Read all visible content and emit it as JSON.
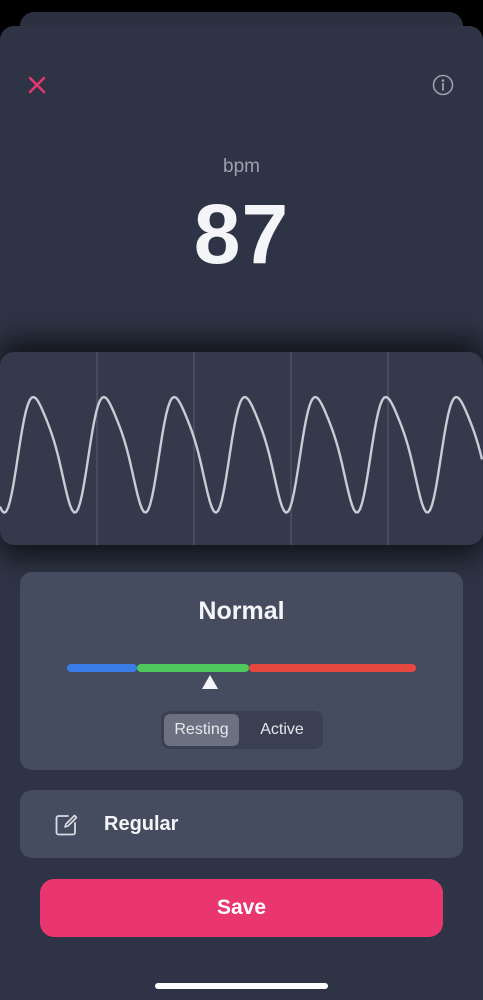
{
  "colors": {
    "accent": "#ea3670",
    "sheet_background": "#2e3445",
    "card_background": "#454c5f",
    "range_low": "#3b7de8",
    "range_normal": "#4ec95e",
    "range_high": "#e5483f"
  },
  "header": {
    "close_icon": "close-x-icon",
    "info_icon": "info-circle-icon"
  },
  "reading": {
    "unit": "bpm",
    "value": "87"
  },
  "waveform": {
    "peak_count": 7,
    "gridline_count": 4
  },
  "status": {
    "label": "Normal",
    "range_fraction": 0.41,
    "modes": [
      {
        "label": "Resting",
        "selected": true
      },
      {
        "label": "Active",
        "selected": false
      }
    ]
  },
  "rhythm": {
    "icon": "edit-note-icon",
    "label": "Regular"
  },
  "actions": {
    "save_label": "Save"
  }
}
